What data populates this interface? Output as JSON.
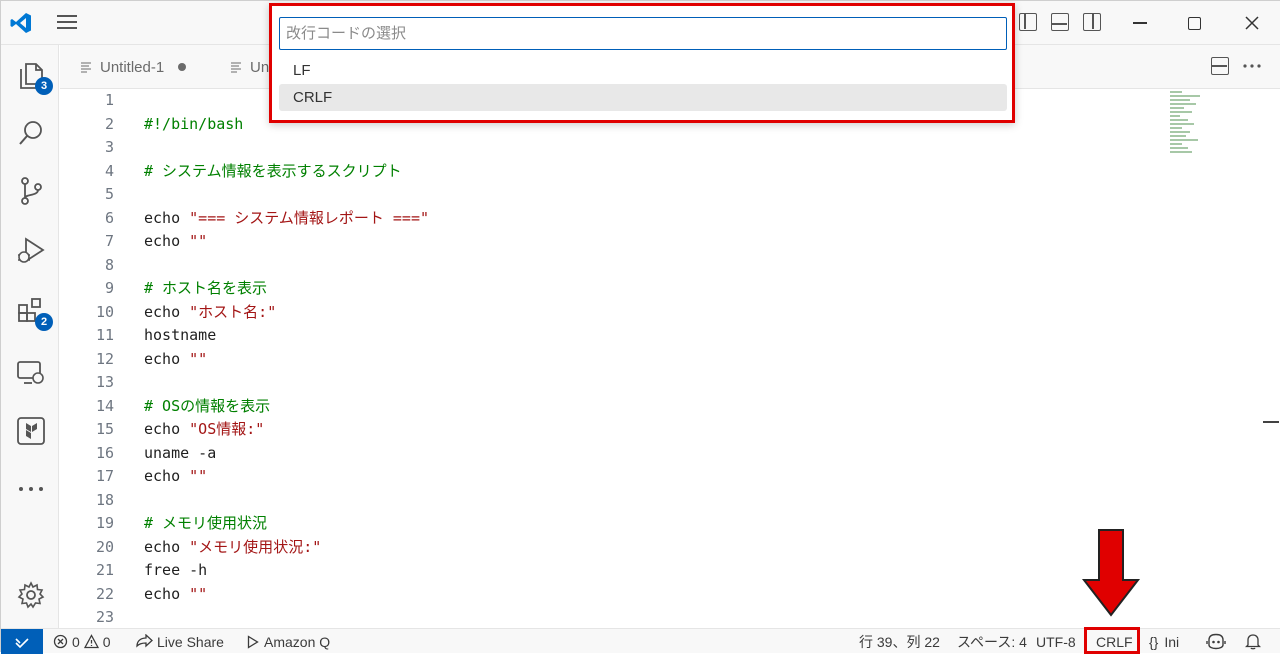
{
  "tabs": [
    {
      "label": "Untitled-1",
      "modified": true
    },
    {
      "label": "Un"
    }
  ],
  "activity": {
    "explorer_badge": "3",
    "extensions_badge": "2"
  },
  "quickpick": {
    "placeholder": "改行コードの選択",
    "items": [
      {
        "label": "LF"
      },
      {
        "label": "CRLF"
      }
    ]
  },
  "editor": {
    "lines": [
      {
        "n": "1",
        "parts": []
      },
      {
        "n": "2",
        "parts": [
          {
            "t": "#!/bin/bash",
            "k": "comment"
          }
        ]
      },
      {
        "n": "3",
        "parts": []
      },
      {
        "n": "4",
        "parts": [
          {
            "t": "# システム情報を表示するスクリプト",
            "k": "comment"
          }
        ]
      },
      {
        "n": "5",
        "parts": []
      },
      {
        "n": "6",
        "parts": [
          {
            "t": "echo ",
            "k": "plain"
          },
          {
            "t": "\"=== システム情報レポート ===\"",
            "k": "str"
          }
        ]
      },
      {
        "n": "7",
        "parts": [
          {
            "t": "echo ",
            "k": "plain"
          },
          {
            "t": "\"\"",
            "k": "str"
          }
        ]
      },
      {
        "n": "8",
        "parts": []
      },
      {
        "n": "9",
        "parts": [
          {
            "t": "# ホスト名を表示",
            "k": "comment"
          }
        ]
      },
      {
        "n": "10",
        "parts": [
          {
            "t": "echo ",
            "k": "plain"
          },
          {
            "t": "\"ホスト名:\"",
            "k": "str"
          }
        ]
      },
      {
        "n": "11",
        "parts": [
          {
            "t": "hostname",
            "k": "plain"
          }
        ]
      },
      {
        "n": "12",
        "parts": [
          {
            "t": "echo ",
            "k": "plain"
          },
          {
            "t": "\"\"",
            "k": "str"
          }
        ]
      },
      {
        "n": "13",
        "parts": []
      },
      {
        "n": "14",
        "parts": [
          {
            "t": "# OSの情報を表示",
            "k": "comment"
          }
        ]
      },
      {
        "n": "15",
        "parts": [
          {
            "t": "echo ",
            "k": "plain"
          },
          {
            "t": "\"OS情報:\"",
            "k": "str"
          }
        ]
      },
      {
        "n": "16",
        "parts": [
          {
            "t": "uname -a",
            "k": "plain"
          }
        ]
      },
      {
        "n": "17",
        "parts": [
          {
            "t": "echo ",
            "k": "plain"
          },
          {
            "t": "\"\"",
            "k": "str"
          }
        ]
      },
      {
        "n": "18",
        "parts": []
      },
      {
        "n": "19",
        "parts": [
          {
            "t": "# メモリ使用状況",
            "k": "comment"
          }
        ]
      },
      {
        "n": "20",
        "parts": [
          {
            "t": "echo ",
            "k": "plain"
          },
          {
            "t": "\"メモリ使用状況:\"",
            "k": "str"
          }
        ]
      },
      {
        "n": "21",
        "parts": [
          {
            "t": "free -h",
            "k": "plain"
          }
        ]
      },
      {
        "n": "22",
        "parts": [
          {
            "t": "echo ",
            "k": "plain"
          },
          {
            "t": "\"\"",
            "k": "str"
          }
        ]
      },
      {
        "n": "23",
        "parts": []
      }
    ]
  },
  "statusbar": {
    "errors": "0",
    "warnings": "0",
    "live_share": "Live Share",
    "amazon_q": "Amazon Q",
    "position": "行 39、列 22",
    "spaces": "スペース: 4",
    "encoding": "UTF-8",
    "eol": "CRLF",
    "language_braces": "{}",
    "language": "Ini"
  },
  "colors": {
    "accent": "#005fb8",
    "highlight": "#e00000",
    "comment": "#008000",
    "string": "#a31515"
  }
}
